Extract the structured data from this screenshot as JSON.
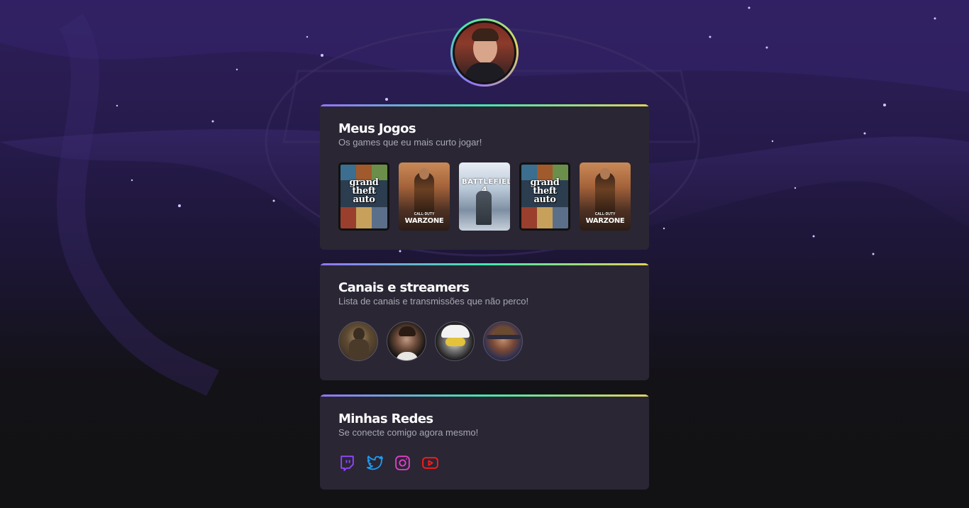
{
  "profile": {
    "avatar_alt": "Foto de perfil"
  },
  "games_card": {
    "title": "Meus Jogos",
    "subtitle": "Os games que eu mais curto jogar!",
    "games": [
      {
        "name": "Grand Theft Auto V",
        "cover_lines": [
          "grand",
          "theft",
          "auto"
        ]
      },
      {
        "name": "Call of Duty Warzone",
        "cover_top": "CALL·DUTY",
        "cover_bottom": "WARZONE"
      },
      {
        "name": "Battlefield 4",
        "cover_text": "BATTLEFIELD 4"
      },
      {
        "name": "Grand Theft Auto V",
        "cover_lines": [
          "grand",
          "theft",
          "auto"
        ]
      },
      {
        "name": "Call of Duty Warzone",
        "cover_top": "CALL·DUTY",
        "cover_bottom": "WARZONE"
      }
    ]
  },
  "streamers_card": {
    "title": "Canais e streamers",
    "subtitle": "Lista de canais e transmissões que não perco!",
    "streamers": [
      "streamer-1",
      "streamer-2",
      "streamer-3",
      "streamer-4"
    ]
  },
  "social_card": {
    "title": "Minhas Redes",
    "subtitle": "Se conecte comigo agora mesmo!",
    "links": [
      {
        "icon": "twitch-icon",
        "color": "#9146ff"
      },
      {
        "icon": "twitter-icon",
        "color": "#1d9bf0"
      },
      {
        "icon": "instagram-icon",
        "color": "#e040c8"
      },
      {
        "icon": "youtube-icon",
        "color": "#ff1a1a"
      }
    ]
  },
  "colors": {
    "background": "#121214",
    "card": "#2a2634",
    "gradient": [
      "#9572fc",
      "#43e7ad",
      "#e2d45c"
    ]
  }
}
